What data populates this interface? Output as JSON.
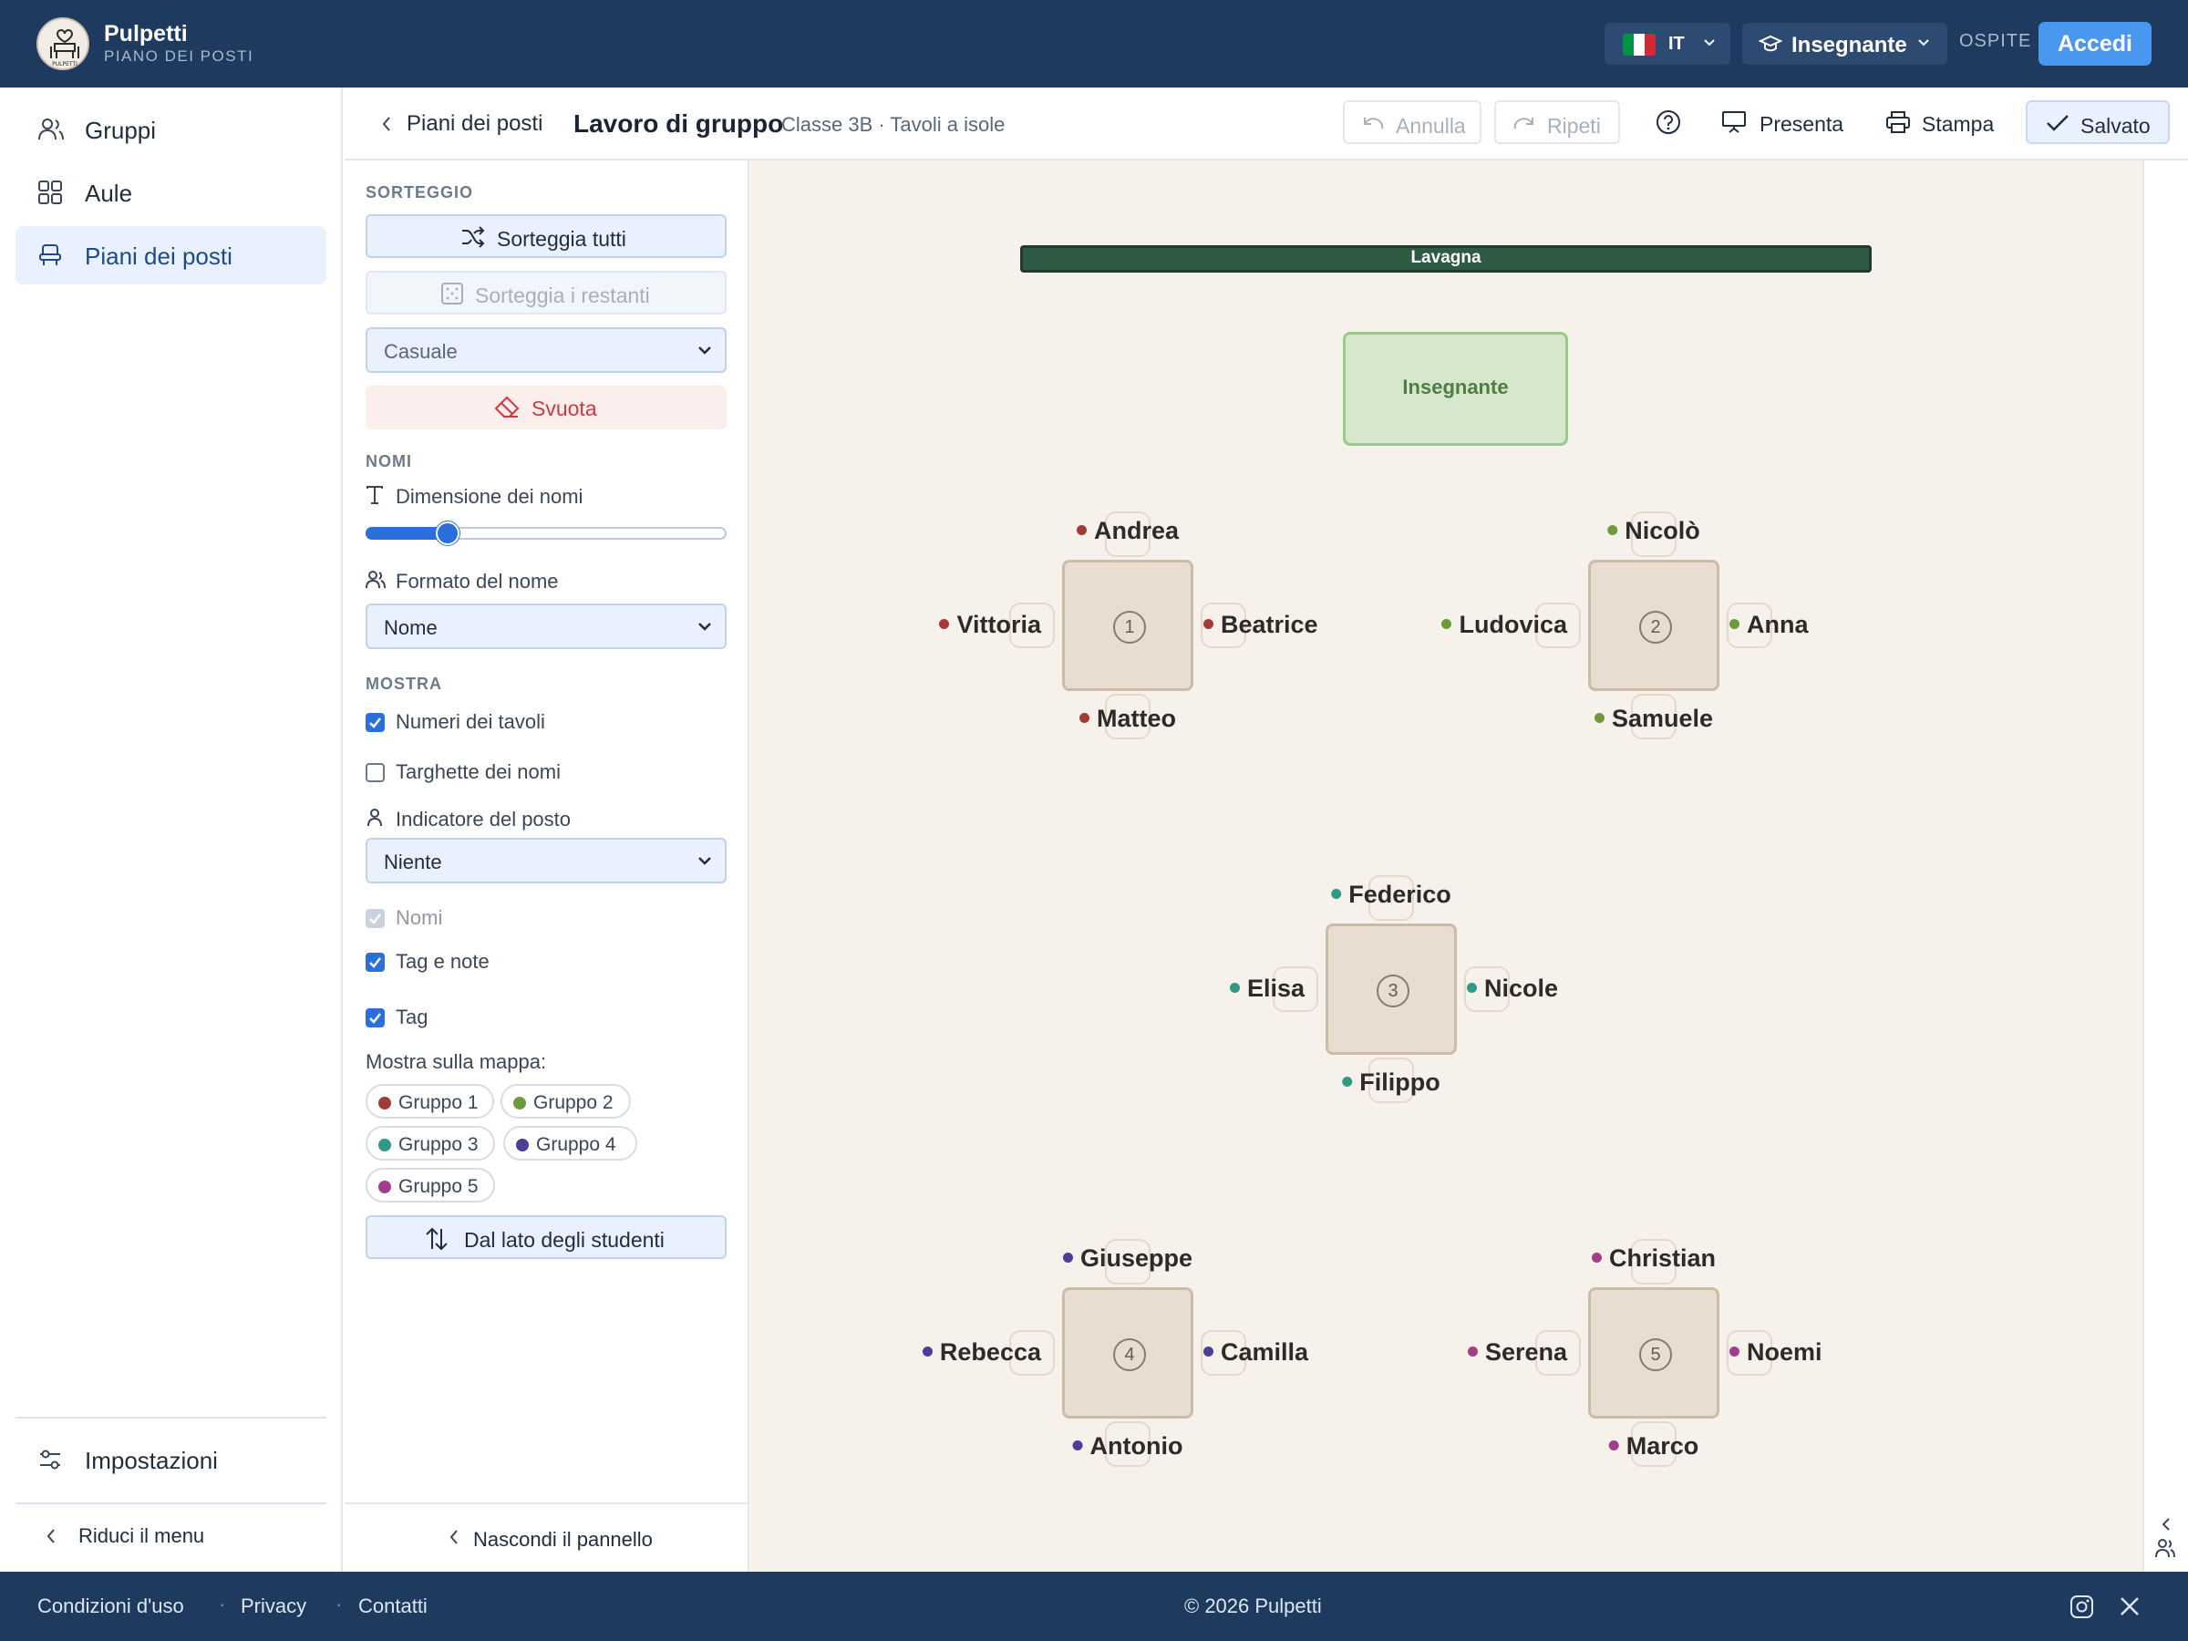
{
  "app": {
    "name": "Pulpetti",
    "subtitle": "PIANO DEI POSTI",
    "logo_text": "PULPETTI"
  },
  "topbar": {
    "language": "IT",
    "role": "Insegnante",
    "guest_label": "OSPITE",
    "login_label": "Accedi",
    "flag_colors": [
      "#009246",
      "#ffffff",
      "#ce2b37"
    ]
  },
  "sidebar": {
    "items": [
      {
        "label": "Gruppi",
        "icon": "users-icon",
        "active": false
      },
      {
        "label": "Aule",
        "icon": "grid-icon",
        "active": false
      },
      {
        "label": "Piani dei posti",
        "icon": "seat-icon",
        "active": true
      }
    ],
    "settings_label": "Impostazioni",
    "collapse_label": "Riduci il menu"
  },
  "header": {
    "back_label": "Piani dei posti",
    "title": "Lavoro di gruppo",
    "meta": "Classe 3B · Tavoli a isole",
    "undo_label": "Annulla",
    "redo_label": "Ripeti",
    "present_label": "Presenta",
    "print_label": "Stampa",
    "saved_label": "Salvato"
  },
  "panel": {
    "draw_section": "SORTEGGIO",
    "shuffle_all_label": "Sorteggia tutti",
    "shuffle_rest_label": "Sorteggia i restanti",
    "mode_value": "Casuale",
    "clear_label": "Svuota",
    "names_section": "NOMI",
    "name_size_label": "Dimensione dei nomi",
    "name_size_value": 0.2,
    "name_format_label": "Formato del nome",
    "name_format_value": "Nome",
    "show_section": "MOSTRA",
    "table_numbers_label": "Numeri dei tavoli",
    "table_numbers_checked": true,
    "name_tags_label": "Targhette dei nomi",
    "name_tags_checked": false,
    "seat_indicator_label": "Indicatore del posto",
    "seat_indicator_value": "Niente",
    "names_label": "Nomi",
    "names_checked": true,
    "tags_notes_label": "Tag e note",
    "tags_notes_checked": true,
    "tag_label": "Tag",
    "tag_checked": true,
    "map_label": "Mostra sulla mappa:",
    "groups": [
      {
        "label": "Gruppo 1",
        "color": "#a33b35"
      },
      {
        "label": "Gruppo 2",
        "color": "#6e9a3a"
      },
      {
        "label": "Gruppo 3",
        "color": "#2f9a86"
      },
      {
        "label": "Gruppo 4",
        "color": "#4a3e96"
      },
      {
        "label": "Gruppo 5",
        "color": "#a23d8c"
      }
    ],
    "student_side_label": "Dal lato degli studenti",
    "hide_panel_label": "Nascondi il pannello"
  },
  "canvas": {
    "board_label": "Lavagna",
    "teacher_label": "Insegnante",
    "tables": [
      {
        "number": "1",
        "group": 0,
        "top": "Andrea",
        "left": "Vittoria",
        "right": "Beatrice",
        "bottom": "Matteo"
      },
      {
        "number": "2",
        "group": 1,
        "top": "Nicolò",
        "left": "Ludovica",
        "right": "Anna",
        "bottom": "Samuele"
      },
      {
        "number": "3",
        "group": 2,
        "top": "Federico",
        "left": "Elisa",
        "right": "Nicole",
        "bottom": "Filippo"
      },
      {
        "number": "4",
        "group": 3,
        "top": "Giuseppe",
        "left": "Rebecca",
        "right": "Camilla",
        "bottom": "Antonio"
      },
      {
        "number": "5",
        "group": 4,
        "top": "Christian",
        "left": "Serena",
        "right": "Noemi",
        "bottom": "Marco"
      }
    ]
  },
  "footer": {
    "links": [
      "Condizioni d'uso",
      "Privacy",
      "Contatti"
    ],
    "copyright": "© 2026 Pulpetti"
  }
}
